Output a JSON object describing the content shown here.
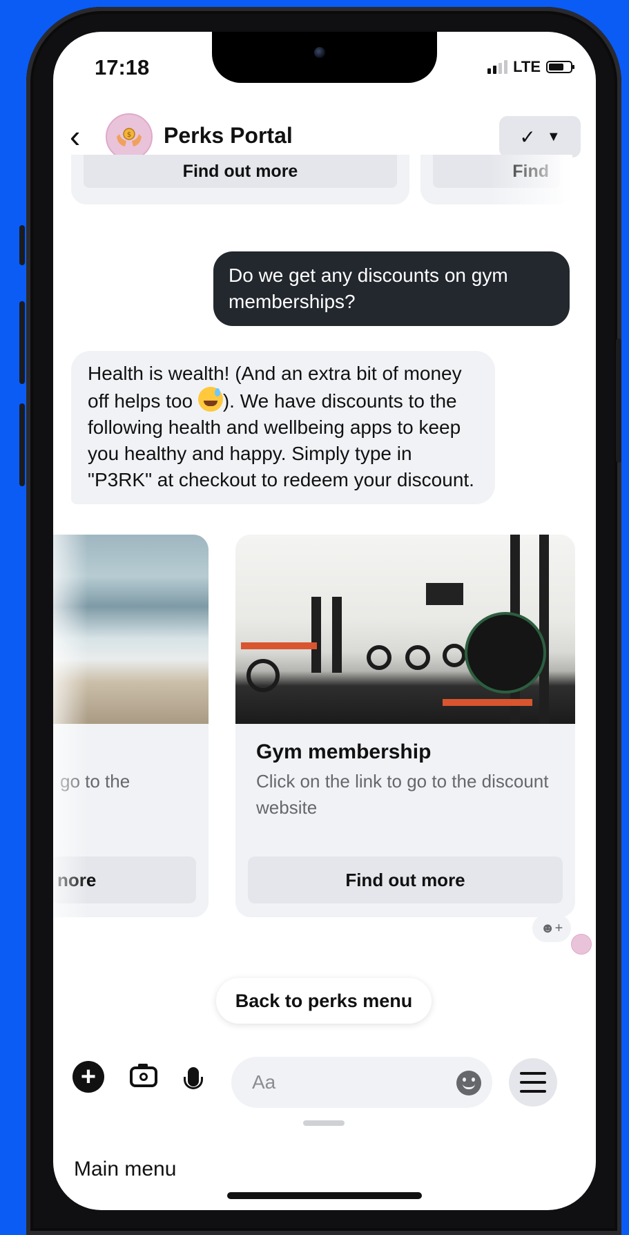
{
  "colors": {
    "background": "#0a5cf5",
    "user_bubble": "#23272e",
    "bot_bubble": "#f0f2f5"
  },
  "status_bar": {
    "time": "17:18",
    "network": "LTE"
  },
  "header": {
    "back_icon": "chevron-left-icon",
    "title": "Perks Portal",
    "avatar_icon": "hands-coin-icon",
    "done_icon": "checkmark-icon",
    "dropdown_icon": "caret-down-icon"
  },
  "previous_carousel": {
    "buttons": [
      "Find out more",
      "Find"
    ]
  },
  "messages": {
    "user": "Do we get any discounts on gym memberships?",
    "bot_before_emoji": "Health is wealth! (And an extra bit of money off helps too ",
    "bot_after_emoji": "). We have discounts to the following health and wellbeing apps to keep you healthy and happy. Simply type in \"P3RK\" at checkout to redeem your discount."
  },
  "carousel": {
    "partial_card": {
      "subtitle_fragment": "go to the",
      "button_fragment": "nore"
    },
    "card": {
      "title": "Gym membership",
      "subtitle": "Click on the link to go to the discount website",
      "button": "Find out more"
    }
  },
  "reaction": {
    "icon": "add-reaction-icon",
    "label": "☻+"
  },
  "quick_reply": "Back to perks menu",
  "composer": {
    "placeholder": "Aa",
    "icons": [
      "plus-icon",
      "camera-icon",
      "microphone-icon",
      "emoji-icon",
      "menu-icon"
    ]
  },
  "bottom": {
    "main_menu": "Main menu"
  }
}
